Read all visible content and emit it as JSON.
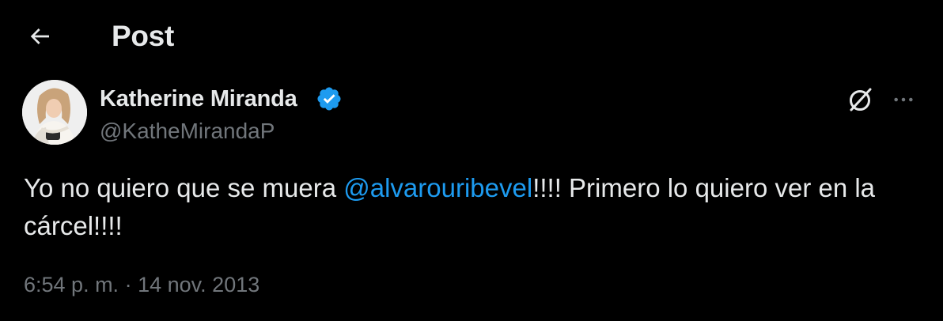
{
  "header": {
    "title": "Post",
    "back_icon": "arrow-left-icon"
  },
  "tweet": {
    "author": {
      "name": "Katherine Miranda",
      "handle": "@KatheMirandaP",
      "verified": true,
      "verified_color": "#1d9bf0"
    },
    "text_before": "Yo no quiero que se muera ",
    "mention": "@alvarouribevel",
    "text_after": "!!!! Primero lo quiero ver en la cárcel!!!!",
    "time": "6:54 p. m.",
    "separator": "·",
    "date": "14 nov. 2013",
    "actions": {
      "grok_icon": "grok-icon",
      "more_icon": "more-dots-icon"
    }
  },
  "colors": {
    "background": "#000000",
    "text_primary": "#e7e9ea",
    "text_secondary": "#71767b",
    "accent": "#1d9bf0"
  }
}
